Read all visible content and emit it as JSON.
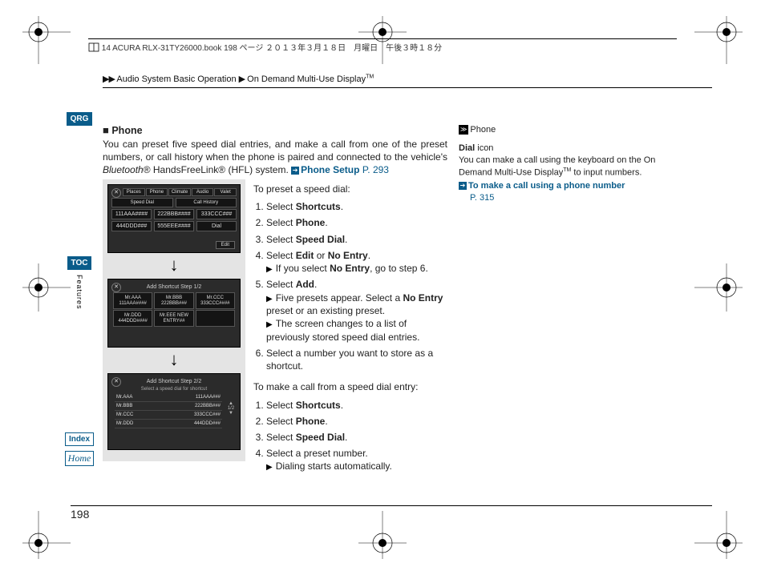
{
  "doc_header": "14 ACURA RLX-31TY26000.book  198 ページ  ２０１３年３月１８日　月曜日　午後３時１８分",
  "breadcrumb": {
    "arrows": "▶▶",
    "part1": "Audio System Basic Operation",
    "sep": "▶",
    "part2": "On Demand Multi-Use Display",
    "tm": "TM"
  },
  "gutter": {
    "qrg": "QRG",
    "toc": "TOC",
    "features": "Features",
    "index": "Index",
    "home": "Home"
  },
  "section": {
    "square": "■",
    "title": "Phone",
    "intro_a": "You can preset five speed dial entries, and make a call from one of the preset numbers, or call history when the phone is paired and connected to the vehicle's ",
    "intro_b_italic": "Bluetooth",
    "intro_c": "® HandsFreeLink® (HFL) system.",
    "link_label": "Phone Setup",
    "link_page": "P. 293"
  },
  "shots": {
    "tabs": [
      "Places",
      "Phone",
      "Climate",
      "Audio",
      "Valet"
    ],
    "row1": [
      "Speed Dial",
      "Call History"
    ],
    "row2a": "111AAA####",
    "row2b": "222BBB####",
    "row2c": "333CCC###",
    "row3a": "444DDD###",
    "row3b": "555EEE####",
    "row3c": "Dial",
    "edit": "Edit",
    "s2_title": "Add Shortcut  Step 1/2",
    "s2_cells": [
      "Mr.AAA\n111AAA####",
      "Mr.BBB\n222BBB###",
      "Mr.CCC\n333CCC####",
      "Mr.DDD\n444DDD####",
      "Mr.EEE\nNEW ENTRY##",
      ""
    ],
    "s3_title": "Add Shortcut  Step 2/2",
    "s3_hint": "Select a speed dial for shortcut",
    "s3_rows": [
      {
        "n": "Mr.AAA",
        "v": "111AAA###"
      },
      {
        "n": "Mr.BBB",
        "v": "222BBB###"
      },
      {
        "n": "Mr.CCC",
        "v": "333CCC###"
      },
      {
        "n": "Mr.DDD",
        "v": "444DDD###"
      }
    ],
    "s3_page": "1/2"
  },
  "steps": {
    "preset_intro": "To preset a speed dial:",
    "p1_a": "Select ",
    "p1_b": "Shortcuts",
    "p1_c": ".",
    "p2_a": "Select ",
    "p2_b": "Phone",
    "p2_c": ".",
    "p3_a": "Select ",
    "p3_b": "Speed Dial",
    "p3_c": ".",
    "p4_a": "Select ",
    "p4_b": "Edit",
    "p4_c": " or ",
    "p4_d": "No Entry",
    "p4_e": ".",
    "p4_sub_a": "If you select ",
    "p4_sub_b": "No Entry",
    "p4_sub_c": ", go to step 6.",
    "p5_a": "Select ",
    "p5_b": "Add",
    "p5_c": ".",
    "p5_sub1_a": "Five presets appear. Select a ",
    "p5_sub1_b": "No Entry",
    "p5_sub1_c": " preset or an existing preset.",
    "p5_sub2": "The screen changes to a list of previously stored speed dial entries.",
    "p6": "Select a number you want to store as a shortcut.",
    "call_intro": "To make a call from a speed dial entry:",
    "c1_a": "Select ",
    "c1_b": "Shortcuts",
    "c1_c": ".",
    "c2_a": "Select ",
    "c2_b": "Phone",
    "c2_c": ".",
    "c3_a": "Select ",
    "c3_b": "Speed Dial",
    "c3_c": ".",
    "c4": "Select a preset number.",
    "c4_sub": "Dialing starts automatically."
  },
  "side": {
    "tag": "≫",
    "tag_label": "Phone",
    "l1_b": "Dial",
    "l1_rest": " icon",
    "l2_a": "You can make a call using the keyboard on the On Demand Multi-Use Display",
    "l2_tm": "TM",
    "l2_b": " to input numbers.",
    "link_label": "To make a call using a phone number",
    "link_page": "P. 315"
  },
  "page_number": "198"
}
